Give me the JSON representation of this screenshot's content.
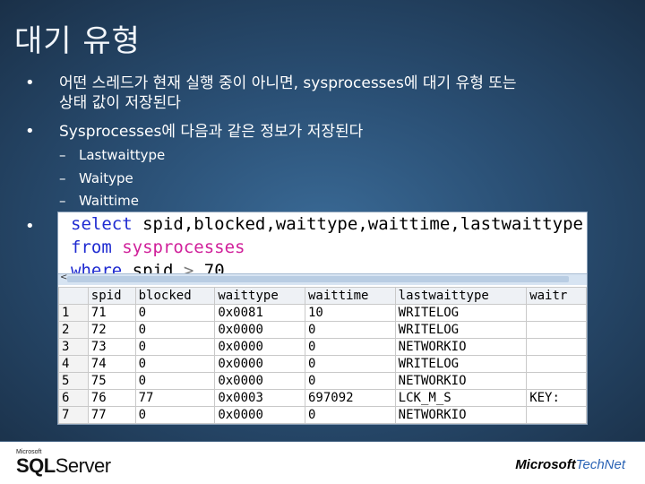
{
  "slide": {
    "title": "대기 유형",
    "bullets": [
      {
        "line1": "어떤 스레드가 현재 실행 중이 아니면, sysprocesses에 대기 유형 또는",
        "line2": "상태 값이 저장된다"
      },
      {
        "line1": "Sysprocesses에 다음과 같은 정보가 저장된다"
      }
    ],
    "sub_items": [
      "Lastwaittype",
      "Waitype",
      "Waittime"
    ],
    "bullet_glyph": "•",
    "dash_glyph": "–"
  },
  "query": {
    "line1_kw": "select",
    "line1_rest": "spid,blocked,waittype,waittime,lastwaittype",
    "line2_kw": "from",
    "line2_rest": "sysprocesses",
    "line3_kw": "where",
    "line3_col": "spid",
    "line3_op": ">",
    "line3_val": "70"
  },
  "scroll": {
    "left_arrow": "<",
    "grip": "|||"
  },
  "results": {
    "columns": [
      "spid",
      "blocked",
      "waittype",
      "waittime",
      "lastwaittype",
      "waitr"
    ],
    "rows": [
      [
        "1",
        "71",
        "0",
        "0x0081",
        "10",
        "WRITELOG",
        ""
      ],
      [
        "2",
        "72",
        "0",
        "0x0000",
        "0",
        "WRITELOG",
        ""
      ],
      [
        "3",
        "73",
        "0",
        "0x0000",
        "0",
        "NETWORKIO",
        ""
      ],
      [
        "4",
        "74",
        "0",
        "0x0000",
        "0",
        "WRITELOG",
        ""
      ],
      [
        "5",
        "75",
        "0",
        "0x0000",
        "0",
        "NETWORKIO",
        ""
      ],
      [
        "6",
        "76",
        "77",
        "0x0003",
        "697092",
        "LCK_M_S",
        "KEY:"
      ],
      [
        "7",
        "77",
        "0",
        "0x0000",
        "0",
        "NETWORKIO",
        ""
      ]
    ]
  },
  "footer": {
    "ms_small": "Microsoft",
    "sql": "SQL",
    "server": "Server",
    "ms_brand": "Microsoft",
    "technet": "TechNet"
  },
  "colors": {
    "background": "#1d3550",
    "keyword": "#1f2bd1",
    "function": "#d0209a"
  }
}
